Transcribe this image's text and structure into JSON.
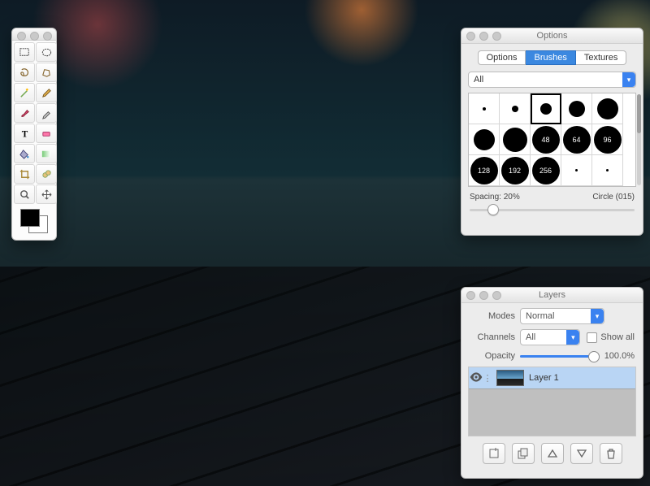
{
  "tools": {
    "items": [
      {
        "name": "rect-select-tool"
      },
      {
        "name": "ellipse-select-tool"
      },
      {
        "name": "lasso-tool"
      },
      {
        "name": "poly-lasso-tool"
      },
      {
        "name": "magic-wand-tool"
      },
      {
        "name": "pencil-tool"
      },
      {
        "name": "brush-tool"
      },
      {
        "name": "eyedropper-tool"
      },
      {
        "name": "text-tool"
      },
      {
        "name": "eraser-tool"
      },
      {
        "name": "bucket-tool"
      },
      {
        "name": "gradient-tool"
      },
      {
        "name": "crop-tool"
      },
      {
        "name": "clone-tool"
      },
      {
        "name": "zoom-tool"
      },
      {
        "name": "move-tool"
      }
    ],
    "fg_color": "#000000",
    "bg_color": "#ffffff"
  },
  "options": {
    "title": "Options",
    "tabs": [
      "Options",
      "Brushes",
      "Textures"
    ],
    "active_tab": 1,
    "category": "All",
    "selected_index": 2,
    "spacing_label": "Spacing: 20%",
    "brush_label": "Circle (015)",
    "brushes": [
      {
        "size": 4,
        "label": ""
      },
      {
        "size": 8,
        "label": ""
      },
      {
        "size": 14,
        "label": ""
      },
      {
        "size": 20,
        "label": ""
      },
      {
        "size": 26,
        "label": ""
      },
      {
        "size": 26,
        "label": ""
      },
      {
        "size": 30,
        "label": ""
      },
      {
        "size": 34,
        "label": "48"
      },
      {
        "size": 34,
        "label": "64"
      },
      {
        "size": 34,
        "label": "96"
      },
      {
        "size": 34,
        "label": "128"
      },
      {
        "size": 34,
        "label": "192"
      },
      {
        "size": 34,
        "label": "256"
      },
      {
        "size": 0,
        "label": ""
      },
      {
        "size": 0,
        "label": ""
      }
    ]
  },
  "layers": {
    "title": "Layers",
    "modes_label": "Modes",
    "mode": "Normal",
    "channels_label": "Channels",
    "channel": "All",
    "show_all_label": "Show all",
    "opacity_label": "Opacity",
    "opacity_value": "100.0%",
    "layer_name": "Layer 1",
    "buttons": [
      "new-layer",
      "duplicate-layer",
      "move-up",
      "move-down",
      "delete-layer"
    ]
  }
}
